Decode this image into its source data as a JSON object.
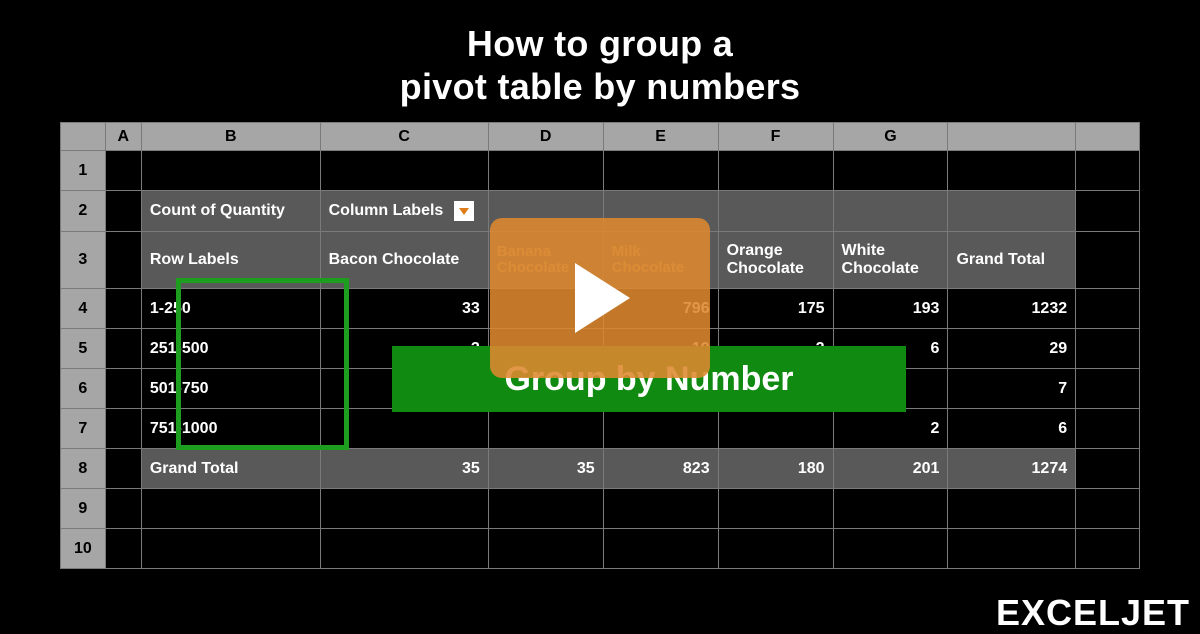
{
  "title_line1": "How to group a",
  "title_line2": "pivot table by numbers",
  "columns": [
    "",
    "A",
    "B",
    "C",
    "D",
    "E",
    "F",
    "G",
    "",
    ""
  ],
  "row_nums": [
    "1",
    "2",
    "3",
    "4",
    "5",
    "6",
    "7",
    "8",
    "9",
    "10"
  ],
  "pivot": {
    "count_label": "Count of Quantity",
    "column_labels": "Column Labels",
    "row_labels": "Row Labels",
    "col_headers": [
      "Bacon Chocolate",
      "Banana Chocolate",
      "Milk Chocolate",
      "Orange Chocolate",
      "White Chocolate",
      "Grand Total"
    ],
    "rows": [
      {
        "label": "1-250",
        "vals": [
          "33",
          "",
          "796",
          "175",
          "193",
          "1232"
        ]
      },
      {
        "label": "251-500",
        "vals": [
          "2",
          "",
          "19",
          "2",
          "6",
          "29"
        ]
      },
      {
        "label": "501-750",
        "vals": [
          "",
          "",
          "",
          "",
          "",
          "7"
        ]
      },
      {
        "label": "751-1000",
        "vals": [
          "",
          "",
          "",
          "",
          "2",
          "6"
        ]
      }
    ],
    "grand_total_label": "Grand Total",
    "grand_total": [
      "35",
      "35",
      "823",
      "180",
      "201",
      "1274"
    ]
  },
  "overlay_label": "Group by Number",
  "brand": "EXCELJET",
  "colors": {
    "green": "#108a10",
    "orange": "#de892f"
  }
}
